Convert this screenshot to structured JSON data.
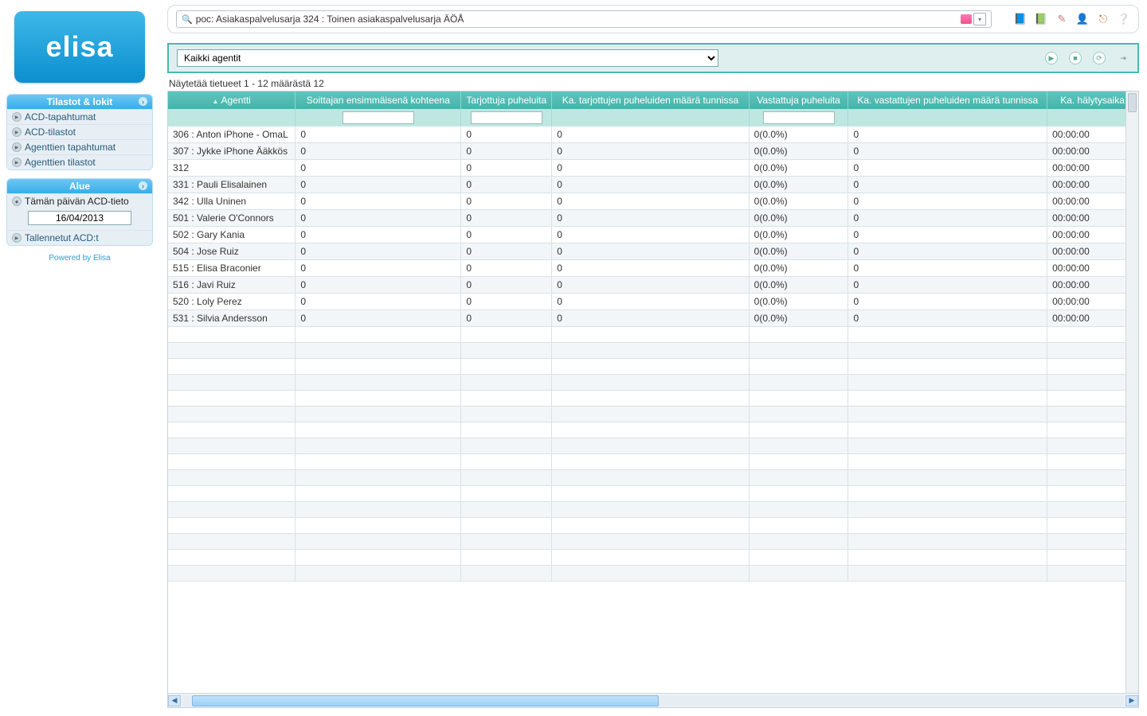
{
  "brand": "elisa",
  "powered_by": "Powered by Elisa",
  "sidebar": {
    "panel1_title": "Tilastot & lokit",
    "panel2_title": "Alue",
    "items1": [
      {
        "label": "ACD-tapahtumat"
      },
      {
        "label": "ACD-tilastot"
      },
      {
        "label": "Agenttien tapahtumat"
      },
      {
        "label": "Agenttien tilastot"
      }
    ],
    "today_label": "Tämän päivän ACD-tieto",
    "date_value": "16/04/2013",
    "saved_label": "Tallennetut ACD:t"
  },
  "search_text": "poc: Asiakaspalvelusarja 324 : Toinen asiakaspalvelusarja ÄÖÅ",
  "agent_filter_label": "Kaikki agentit",
  "count_line": "Näytetää tietueet 1 - 12 määrästä 12",
  "columns": [
    "Agentti",
    "Soittajan ensimmäisenä kohteena",
    "Tarjottuja puheluita",
    "Ka. tarjottujen puheluiden määrä tunnissa",
    "Vastattuja puheluita",
    "Ka. vastattujen puheluiden määrä tunnissa",
    "Ka. hälytysaika"
  ],
  "rows": [
    {
      "agent": "306 : Anton iPhone - OmaL",
      "c1": "0",
      "c2": "0",
      "c3": "0",
      "c4": "0(0.0%)",
      "c5": "0",
      "c6": "00:00:00"
    },
    {
      "agent": "307 : Jykke iPhone Ääkkös",
      "c1": "0",
      "c2": "0",
      "c3": "0",
      "c4": "0(0.0%)",
      "c5": "0",
      "c6": "00:00:00"
    },
    {
      "agent": "312",
      "c1": "0",
      "c2": "0",
      "c3": "0",
      "c4": "0(0.0%)",
      "c5": "0",
      "c6": "00:00:00"
    },
    {
      "agent": "331 : Pauli Elisalainen",
      "c1": "0",
      "c2": "0",
      "c3": "0",
      "c4": "0(0.0%)",
      "c5": "0",
      "c6": "00:00:00"
    },
    {
      "agent": "342 : Ulla Uninen",
      "c1": "0",
      "c2": "0",
      "c3": "0",
      "c4": "0(0.0%)",
      "c5": "0",
      "c6": "00:00:00"
    },
    {
      "agent": "501 : Valerie O'Connors",
      "c1": "0",
      "c2": "0",
      "c3": "0",
      "c4": "0(0.0%)",
      "c5": "0",
      "c6": "00:00:00"
    },
    {
      "agent": "502 : Gary Kania",
      "c1": "0",
      "c2": "0",
      "c3": "0",
      "c4": "0(0.0%)",
      "c5": "0",
      "c6": "00:00:00"
    },
    {
      "agent": "504 : Jose Ruiz",
      "c1": "0",
      "c2": "0",
      "c3": "0",
      "c4": "0(0.0%)",
      "c5": "0",
      "c6": "00:00:00"
    },
    {
      "agent": "515 : Elisa Braconier",
      "c1": "0",
      "c2": "0",
      "c3": "0",
      "c4": "0(0.0%)",
      "c5": "0",
      "c6": "00:00:00"
    },
    {
      "agent": "516 : Javi Ruiz",
      "c1": "0",
      "c2": "0",
      "c3": "0",
      "c4": "0(0.0%)",
      "c5": "0",
      "c6": "00:00:00"
    },
    {
      "agent": "520 : Loly Perez",
      "c1": "0",
      "c2": "0",
      "c3": "0",
      "c4": "0(0.0%)",
      "c5": "0",
      "c6": "00:00:00"
    },
    {
      "agent": "531 : Silvia Andersson",
      "c1": "0",
      "c2": "0",
      "c3": "0",
      "c4": "0(0.0%)",
      "c5": "0",
      "c6": "00:00:00"
    }
  ]
}
